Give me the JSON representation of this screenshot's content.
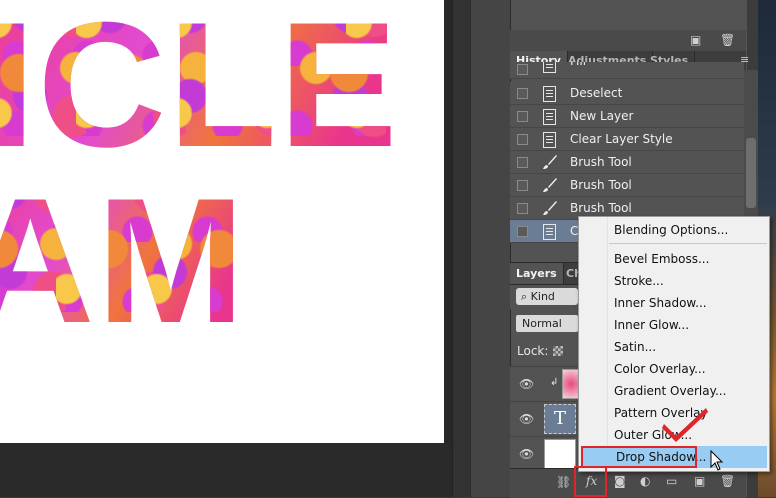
{
  "canvas": {
    "line1": "ICLE",
    "line2": "AM"
  },
  "history": {
    "tabs": [
      "History",
      "Adjustments",
      "Styles"
    ],
    "items": [
      {
        "label": "Fill",
        "icon": "doc-icon"
      },
      {
        "label": "Deselect",
        "icon": "doc-icon"
      },
      {
        "label": "New Layer",
        "icon": "doc-icon"
      },
      {
        "label": "Clear Layer Style",
        "icon": "doc-icon"
      },
      {
        "label": "Brush Tool",
        "icon": "brush-icon"
      },
      {
        "label": "Brush Tool",
        "icon": "brush-icon"
      },
      {
        "label": "Brush Tool",
        "icon": "brush-icon"
      },
      {
        "label": "C",
        "icon": "doc-icon"
      }
    ]
  },
  "layers": {
    "tabs": [
      "Layers",
      "Ch"
    ],
    "kind_label": "Kind",
    "blend_mode": "Normal",
    "lock_label": "Lock:",
    "rows": [
      {
        "thumb": "flower-thumb"
      },
      {
        "thumb": "text-thumb",
        "thumb_text": "T"
      },
      {
        "thumb": "white-thumb"
      }
    ],
    "footer": {
      "fx_label": "fx"
    }
  },
  "context_menu": {
    "items": [
      "Blending Options...",
      "Bevel  Emboss...",
      "Stroke...",
      "Inner Shadow...",
      "Inner Glow...",
      "Satin...",
      "Color Overlay...",
      "Gradient Overlay...",
      "Pattern Overlay",
      "Outer Glow...",
      "Drop Shadow..."
    ],
    "highlighted": "Drop Shadow..."
  },
  "colors": {
    "highlight_red": "#e0242a",
    "menu_highlight": "#99ccf3",
    "selected_row": "#6b7d95"
  }
}
